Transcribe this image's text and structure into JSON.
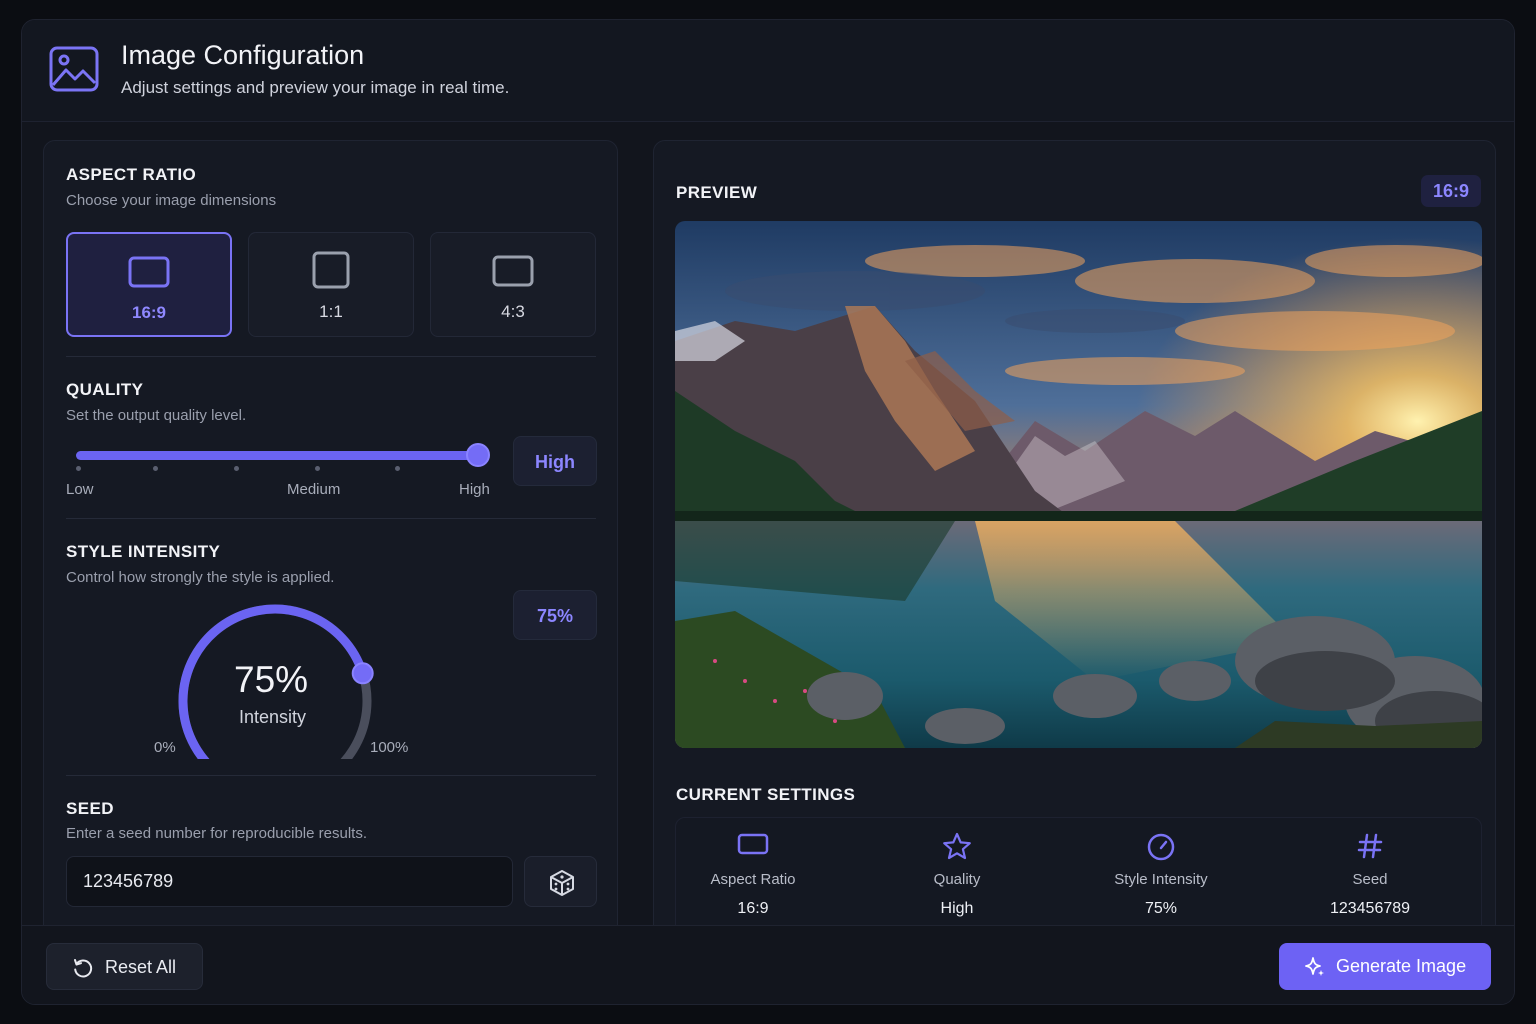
{
  "header": {
    "title": "Image Configuration",
    "subtitle": "Adjust settings and preview your image in real time.",
    "icon": "image-icon"
  },
  "aspect_ratio": {
    "title": "ASPECT RATIO",
    "subtitle": "Choose your image dimensions",
    "options": [
      {
        "label": "16:9",
        "selected": true
      },
      {
        "label": "1:1",
        "selected": false
      },
      {
        "label": "4:3",
        "selected": false
      }
    ]
  },
  "quality": {
    "title": "QUALITY",
    "subtitle": "Set the output quality level.",
    "labels": {
      "low": "Low",
      "medium": "Medium",
      "high": "High"
    },
    "value": "High",
    "level_fraction": 1.0
  },
  "style_intensity": {
    "title": "STYLE INTENSITY",
    "subtitle": "Control how strongly the style is applied.",
    "badge": "75%",
    "gauge_value": "75%",
    "gauge_label": "Intensity",
    "min_label": "0%",
    "max_label": "100%",
    "level_percent": 75
  },
  "seed": {
    "title": "SEED",
    "subtitle": "Enter a seed number for reproducible results.",
    "value": "123456789",
    "randomize_icon": "dice-icon"
  },
  "preview": {
    "title": "PREVIEW",
    "badge": "16:9"
  },
  "current_settings": {
    "title": "CURRENT SETTINGS",
    "items": [
      {
        "name": "Aspect Ratio",
        "value": "16:9",
        "icon": "aspect-ratio-icon"
      },
      {
        "name": "Quality",
        "value": "High",
        "icon": "star-icon"
      },
      {
        "name": "Style Intensity",
        "value": "75%",
        "icon": "gauge-icon"
      },
      {
        "name": "Seed",
        "value": "123456789",
        "icon": "hash-icon"
      }
    ]
  },
  "footer": {
    "reset_label": "Reset All",
    "generate_label": "Generate Image"
  },
  "colors": {
    "accent": "#6d62f4",
    "accent_text": "#8c86ff",
    "background": "#0b0d12",
    "panel": "#151923"
  }
}
